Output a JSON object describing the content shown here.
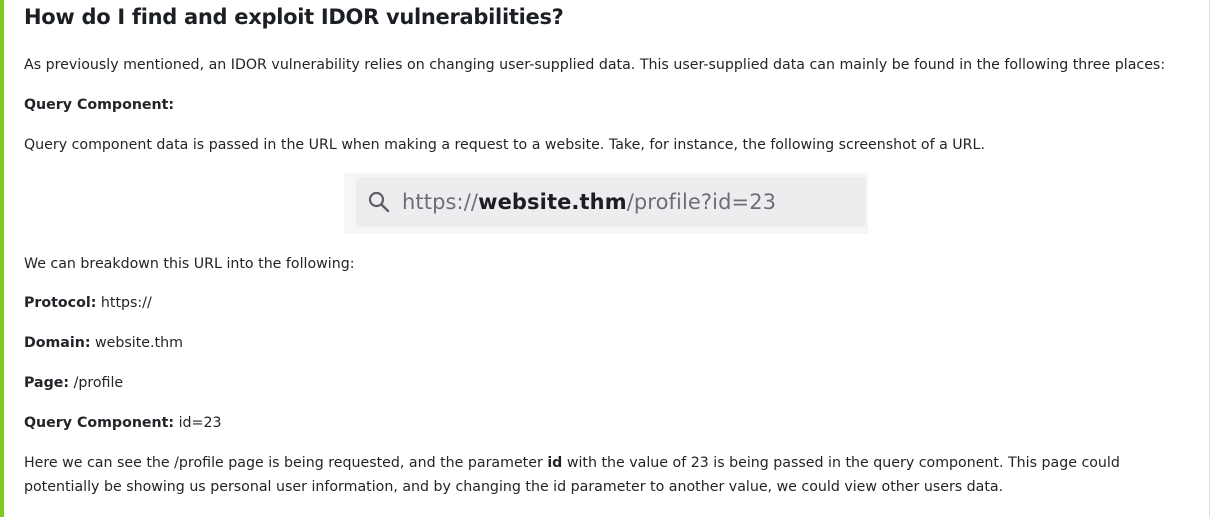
{
  "heading": "How do I find and exploit IDOR vulnerabilities?",
  "intro": "As previously mentioned, an IDOR vulnerability relies on changing user-supplied data. This user-supplied data can mainly be found in the following three places:",
  "section_label": "Query Component:",
  "section_text": "Query component data is passed in the URL when making a request to a website. Take, for instance, the following screenshot of a URL.",
  "url_bar": {
    "icon": "search-icon",
    "protocol": "https://",
    "domain": "website.thm",
    "path": "/profile?id=23"
  },
  "breakdown_intro": "We can breakdown this URL into the following:",
  "breakdown": {
    "protocol": {
      "label": "Protocol:",
      "value": "https://"
    },
    "domain": {
      "label": "Domain:",
      "value": "website.thm"
    },
    "page": {
      "label": "Page:",
      "value": "/profile"
    },
    "query": {
      "label": "Query Component:",
      "value": "id=23"
    }
  },
  "conclusion": {
    "before": "Here we can see the /profile page is being requested, and the parameter ",
    "param": "id",
    "after": " with the value of 23 is being passed in the query component. This page could potentially be showing us personal user information, and by changing the id parameter to another value, we could view other users data."
  },
  "colors": {
    "accent": "#7dcb1d",
    "text": "#212529",
    "url_bg": "#ededf0"
  }
}
